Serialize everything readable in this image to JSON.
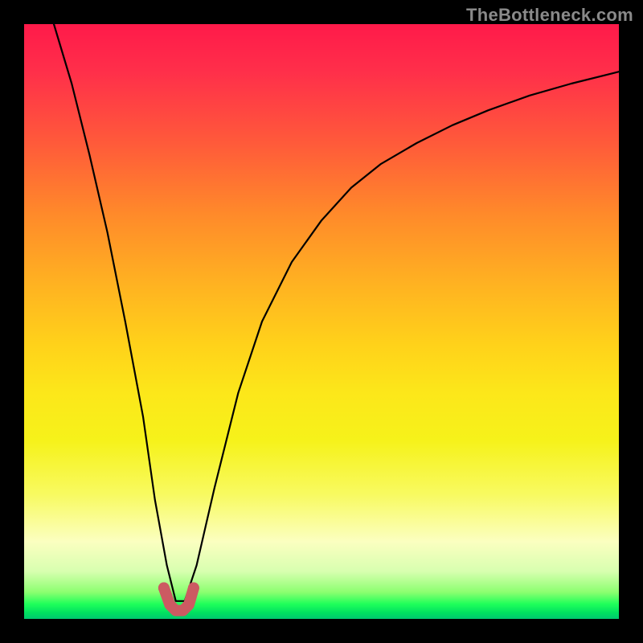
{
  "watermark": "TheBottleneck.com",
  "chart_data": {
    "type": "line",
    "title": "",
    "xlabel": "",
    "ylabel": "",
    "xlim": [
      0,
      100
    ],
    "ylim": [
      0,
      100
    ],
    "series": [
      {
        "name": "main-curve",
        "x": [
          5,
          8,
          11,
          14,
          17,
          20,
          22,
          24,
          25.5,
          27,
          29,
          32,
          36,
          40,
          45,
          50,
          55,
          60,
          66,
          72,
          78,
          85,
          92,
          100
        ],
        "y": [
          100,
          90,
          78,
          65,
          50,
          34,
          20,
          9,
          3,
          3,
          9,
          22,
          38,
          50,
          60,
          67,
          72.5,
          76.5,
          80,
          83,
          85.5,
          88,
          90,
          92
        ]
      },
      {
        "name": "bottom-stub",
        "x": [
          23.5,
          24.5,
          25.5,
          26.7,
          27.7,
          28.5
        ],
        "y": [
          5.2,
          2.4,
          1.4,
          1.4,
          2.4,
          5.2
        ]
      }
    ],
    "colors": {
      "curve": "#000000",
      "stub": "#cc5a62",
      "gradient_top": "#ff1a4a",
      "gradient_mid": "#ffd21a",
      "gradient_bottom": "#00c870"
    }
  }
}
